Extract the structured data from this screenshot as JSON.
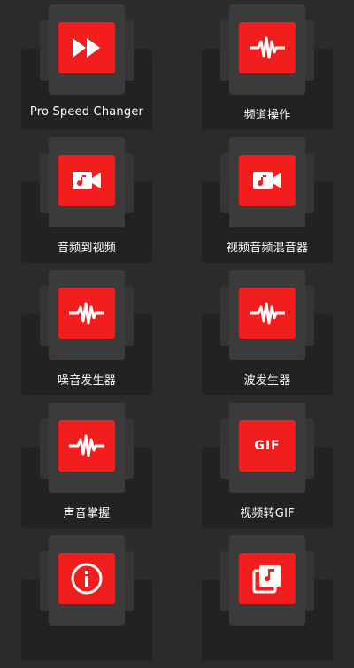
{
  "tiles": [
    {
      "label": "Pro Speed Changer",
      "icon": "fast-forward-icon"
    },
    {
      "label": "频道操作",
      "icon": "waveform-icon"
    },
    {
      "label": "音频到视频",
      "icon": "music-video-icon"
    },
    {
      "label": "视频音频混音器",
      "icon": "music-video-icon"
    },
    {
      "label": "噪音发生器",
      "icon": "waveform-icon"
    },
    {
      "label": "波发生器",
      "icon": "waveform-icon"
    },
    {
      "label": "声音掌握",
      "icon": "waveform-icon"
    },
    {
      "label": "视频转GIF",
      "icon": "gif-icon"
    },
    {
      "label": "",
      "icon": "info-icon"
    },
    {
      "label": "",
      "icon": "music-library-icon"
    }
  ],
  "gif_text": "GIF",
  "colors": {
    "accent": "#f21d1d",
    "background": "#2b2b2b",
    "tile": "#222222"
  }
}
